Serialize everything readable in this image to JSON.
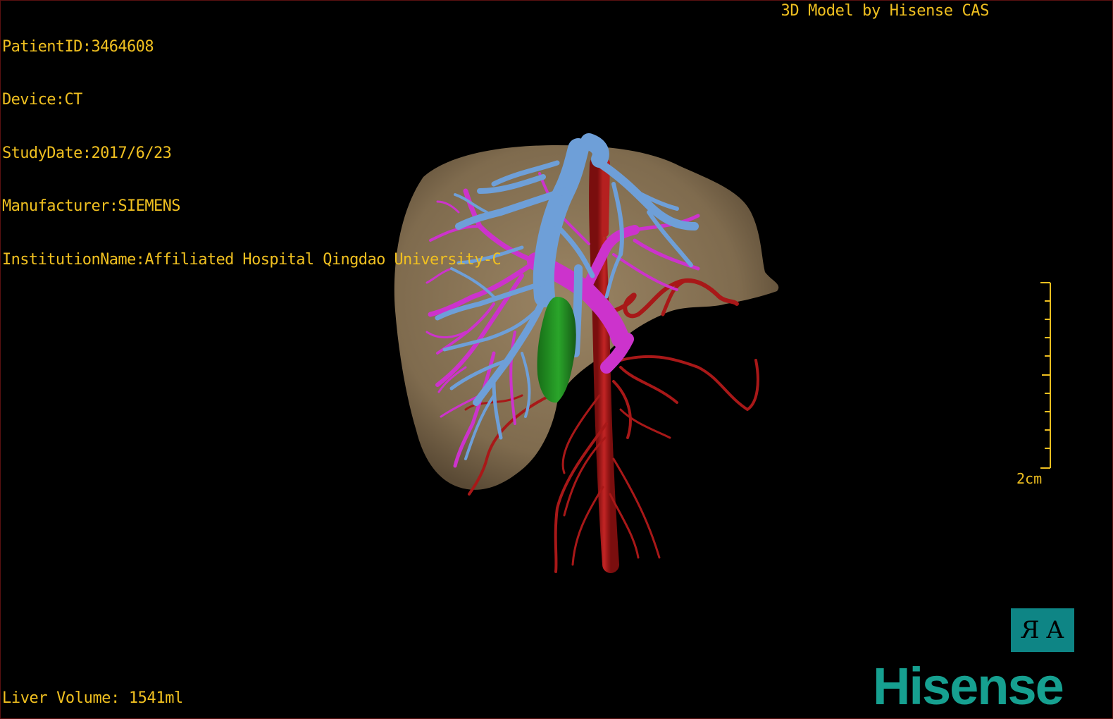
{
  "viewer": {
    "patient_id_line": "PatientID:3464608",
    "device_line": "Device:CT",
    "study_date_line": "StudyDate:2017/6/23",
    "manufacturer_line": "Manufacturer:SIEMENS",
    "institution_line": "InstitutionName:Affiliated Hospital Qingdao University-C",
    "credit": "3D Model by Hisense CAS",
    "liver_volume_line": "Liver Volume: 1541ml",
    "scale_label": "2cm",
    "orientation_marker": {
      "left_glyph": "R",
      "right_glyph": "A"
    },
    "brand": "Hisense"
  },
  "colors": {
    "text": "#f0c020",
    "liver": "#8a7556",
    "hepatic_vein": "#6e9fd8",
    "portal_vein": "#cc33cc",
    "artery": "#a81818",
    "gallbladder": "#1f8a1f",
    "brand": "#16a090",
    "orientation_box": "#0e8585"
  }
}
